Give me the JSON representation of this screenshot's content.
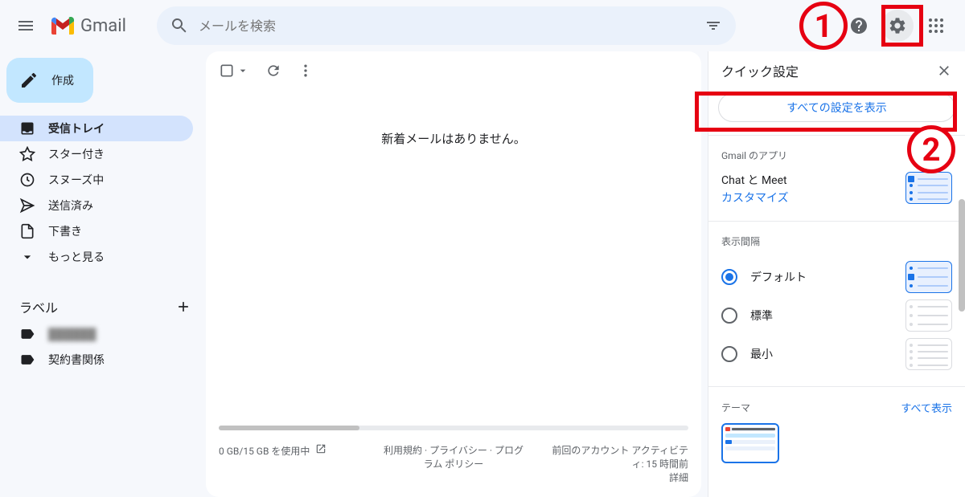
{
  "header": {
    "logo_text": "Gmail",
    "search_placeholder": "メールを検索"
  },
  "sidebar": {
    "compose_label": "作成",
    "items": [
      {
        "label": "受信トレイ",
        "icon": "inbox"
      },
      {
        "label": "スター付き",
        "icon": "star"
      },
      {
        "label": "スヌーズ中",
        "icon": "clock"
      },
      {
        "label": "送信済み",
        "icon": "send"
      },
      {
        "label": "下書き",
        "icon": "draft"
      },
      {
        "label": "もっと見る",
        "icon": "expand"
      }
    ],
    "labels_header": "ラベル",
    "labels": [
      {
        "label": "██████",
        "blurred": true
      },
      {
        "label": "契約書関係",
        "blurred": false
      }
    ]
  },
  "main": {
    "empty_message": "新着メールはありません。",
    "footer": {
      "storage": "0 GB/15 GB を使用中",
      "policies": "利用規約 · プライバシー · プログラム ポリシー",
      "activity_line1": "前回のアカウント アクティビティ: 15 時間前",
      "activity_line2": "詳細"
    }
  },
  "panel": {
    "title": "クイック設定",
    "all_settings_label": "すべての設定を表示",
    "apps_section_title": "Gmail のアプリ",
    "apps_chat_meet": "Chat と Meet",
    "apps_customize": "カスタマイズ",
    "density_section_title": "表示間隔",
    "density_options": [
      {
        "label": "デフォルト"
      },
      {
        "label": "標準"
      },
      {
        "label": "最小"
      }
    ],
    "theme_section_title": "テーマ",
    "theme_view_all": "すべて表示"
  },
  "annotations": {
    "one": "1",
    "two": "2"
  }
}
